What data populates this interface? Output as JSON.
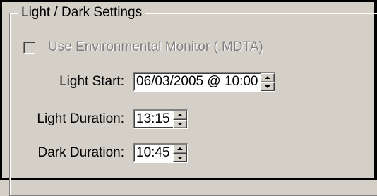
{
  "group": {
    "title": "Light / Dark Settings"
  },
  "checkbox": {
    "label": "Use Environmental Monitor (.MDTA)",
    "checked": false,
    "disabled": true
  },
  "fields": {
    "light_start": {
      "label": "Light Start:",
      "value": "06/03/2005 @ 10:00"
    },
    "light_duration": {
      "label": "Light Duration:",
      "value": "13:15"
    },
    "dark_duration": {
      "label": "Dark Duration:",
      "value": "10:45"
    }
  },
  "icons": {
    "spin_up": "chevron-up-icon",
    "spin_down": "chevron-down-icon"
  },
  "colors": {
    "background": "#d4d0c8",
    "disabled_text": "#808080",
    "field_background": "#ffffff"
  }
}
